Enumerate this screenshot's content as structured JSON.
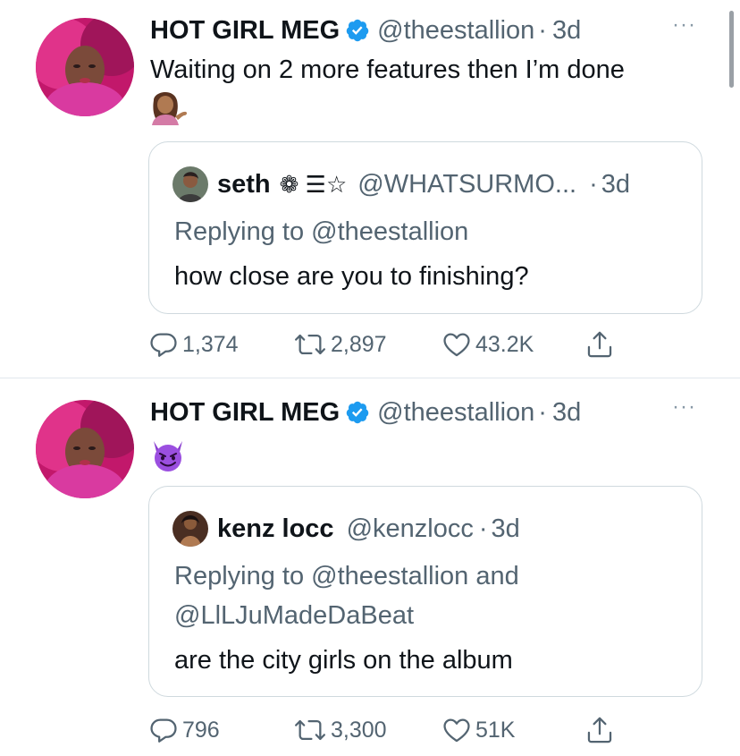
{
  "colors": {
    "verified": "#1d9bf0",
    "muted": "#536471",
    "text": "#0f1419",
    "border": "#cfd9de"
  },
  "tweets": [
    {
      "author_name": "HOT GIRL MEG",
      "author_handle": "@theestallion",
      "dot": "·",
      "time": "3d",
      "more": "···",
      "text": "Waiting on 2 more features then I’m done",
      "emoji": "💁🏽‍♀️",
      "quote": {
        "name": "seth",
        "glyphs": "❁ ☰☆",
        "handle": "@WHATSURMO...",
        "dot": "·",
        "time": "3d",
        "replying": "Replying to @theestallion",
        "text": "how close are you to finishing?"
      },
      "actions": {
        "replies": "1,374",
        "retweets": "2,897",
        "likes": "43.2K"
      }
    },
    {
      "author_name": "HOT GIRL MEG",
      "author_handle": "@theestallion",
      "dot": "·",
      "time": "3d",
      "more": "···",
      "emoji": "😈",
      "quote": {
        "name": "kenz locc",
        "handle": "@kenzlocc",
        "dot": "·",
        "time": "3d",
        "replying": "Replying to @theestallion and @LlLJuMadeDaBeat",
        "text": "are the city girls on the album"
      },
      "actions": {
        "replies": "796",
        "retweets": "3,300",
        "likes": "51K"
      }
    }
  ],
  "icons": {
    "avatar": "profile-photo",
    "verified": "verified-badge-icon",
    "reply": "reply-icon",
    "retweet": "retweet-icon",
    "like": "heart-icon",
    "share": "share-icon",
    "more": "more-icon"
  }
}
